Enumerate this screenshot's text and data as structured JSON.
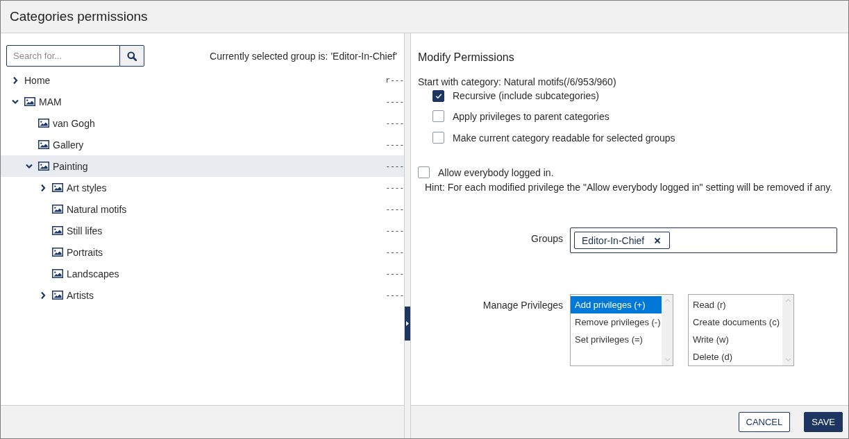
{
  "window": {
    "title": "Categories permissions"
  },
  "left_panel": {
    "search": {
      "placeholder": "Search for..."
    },
    "selected_group_note": "Currently selected group is: 'Editor-In-Chief'",
    "tree": [
      {
        "label": "Home",
        "kind": "root",
        "permissions": "r---",
        "expandable": true,
        "expanded": false,
        "selected": false
      },
      {
        "label": "MAM",
        "kind": "category",
        "permissions": "----",
        "expandable": true,
        "expanded": true,
        "selected": false,
        "children": [
          {
            "label": "van Gogh",
            "kind": "category",
            "permissions": "----",
            "expandable": false,
            "expanded": false,
            "selected": false
          },
          {
            "label": "Gallery",
            "kind": "category",
            "permissions": "----",
            "expandable": false,
            "expanded": false,
            "selected": false
          },
          {
            "label": "Painting",
            "kind": "category",
            "permissions": "----",
            "expandable": true,
            "expanded": true,
            "selected": true,
            "children": [
              {
                "label": "Art styles",
                "kind": "category",
                "permissions": "----",
                "expandable": true,
                "expanded": false,
                "selected": false
              },
              {
                "label": "Natural motifs",
                "kind": "category",
                "permissions": "----",
                "expandable": false,
                "expanded": false,
                "selected": false
              },
              {
                "label": "Still lifes",
                "kind": "category",
                "permissions": "----",
                "expandable": false,
                "expanded": false,
                "selected": false
              },
              {
                "label": "Portraits",
                "kind": "category",
                "permissions": "----",
                "expandable": false,
                "expanded": false,
                "selected": false
              },
              {
                "label": "Landscapes",
                "kind": "category",
                "permissions": "----",
                "expandable": false,
                "expanded": false,
                "selected": false
              },
              {
                "label": "Artists",
                "kind": "category",
                "permissions": "----",
                "expandable": true,
                "expanded": false,
                "selected": false
              }
            ]
          }
        ]
      }
    ]
  },
  "right_panel": {
    "heading": "Modify Permissions",
    "start_category": "Start with category: Natural motifs(/6/953/960)",
    "options": [
      {
        "label": "Recursive (include subcategories)",
        "checked": true
      },
      {
        "label": "Apply privileges to parent categories",
        "checked": false
      },
      {
        "label": "Make current category readable for selected groups",
        "checked": false
      }
    ],
    "allow_everybody": {
      "label": "Allow everybody logged in.",
      "checked": false
    },
    "hint": "Hint: For each modified privilege the \"Allow everybody logged in\" setting will be removed if any.",
    "groups": {
      "label": "Groups",
      "tags": [
        "Editor-In-Chief"
      ]
    },
    "manage_privileges": {
      "label": "Manage Privileges",
      "modes": [
        {
          "label": "Add privileges (+)",
          "selected": true
        },
        {
          "label": "Remove privileges (-)",
          "selected": false
        },
        {
          "label": "Set privileges (=)",
          "selected": false
        }
      ],
      "privileges": [
        {
          "label": "Read (r)",
          "selected": false
        },
        {
          "label": "Create documents (c)",
          "selected": false
        },
        {
          "label": "Write (w)",
          "selected": false
        },
        {
          "label": "Delete (d)",
          "selected": false
        }
      ]
    }
  },
  "footer": {
    "buttons": [
      {
        "label": "CANCEL",
        "kind": "secondary"
      },
      {
        "label": "SAVE",
        "kind": "primary"
      }
    ]
  }
}
